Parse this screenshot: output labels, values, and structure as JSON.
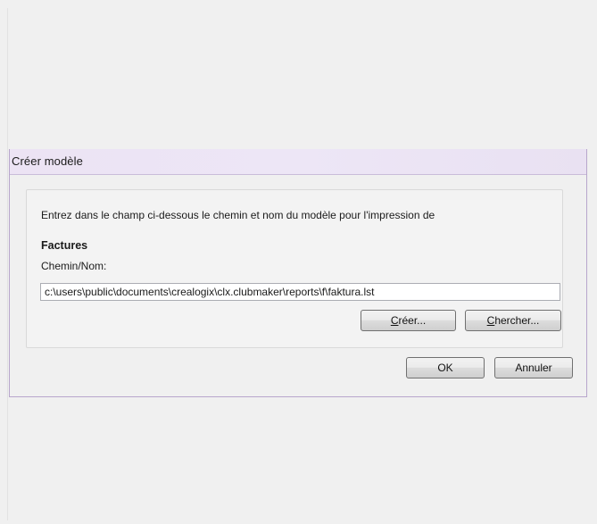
{
  "dialog": {
    "title": "Créer modèle",
    "intro_text": "Entrez dans le champ ci-dessous le chemin et nom du modèle pour l'impression de",
    "section_heading": "Factures",
    "path_label": "Chemin/Nom:",
    "path_value": "c:\\users\\public\\documents\\crealogix\\clx.clubmaker\\reports\\f\\faktura.lst",
    "buttons": {
      "creer": {
        "mnemonic": "C",
        "rest": "réer..."
      },
      "chercher": {
        "mnemonic": "C",
        "rest": "hercher..."
      },
      "ok": "OK",
      "annuler": "Annuler"
    }
  }
}
